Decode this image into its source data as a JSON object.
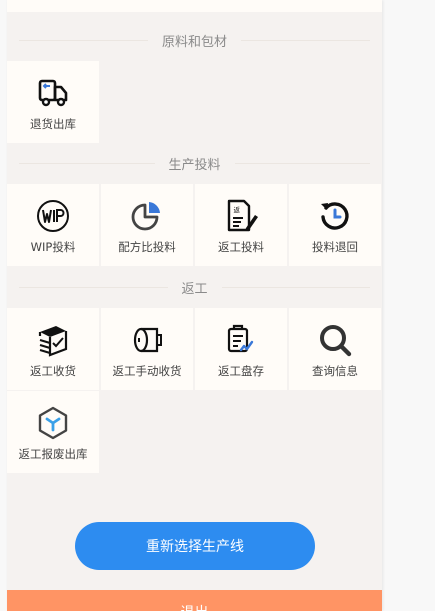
{
  "sections": [
    {
      "title": "原料和包材",
      "items": [
        {
          "label": "退货出库",
          "icon": "truck-icon"
        }
      ]
    },
    {
      "title": "生产投料",
      "items": [
        {
          "label": "WIP投料",
          "icon": "wip-icon"
        },
        {
          "label": "配方比投料",
          "icon": "pie-chart-icon"
        },
        {
          "label": "返工投料",
          "icon": "document-edit-icon"
        },
        {
          "label": "投料退回",
          "icon": "undo-clock-icon"
        }
      ]
    },
    {
      "title": "返工",
      "items": [
        {
          "label": "返工收货",
          "icon": "box-stack-icon"
        },
        {
          "label": "返工手动收货",
          "icon": "roll-icon"
        },
        {
          "label": "返工盘存",
          "icon": "clipboard-icon"
        },
        {
          "label": "查询信息",
          "icon": "search-icon"
        },
        {
          "label": "返工报废出库",
          "icon": "cube-icon"
        }
      ]
    }
  ],
  "buttons": {
    "reselect_line": "重新选择生产线",
    "exit": "退出"
  },
  "colors": {
    "primary": "#2d8cf0",
    "exit": "#ff9464",
    "icon_blue": "#3a78d8"
  }
}
